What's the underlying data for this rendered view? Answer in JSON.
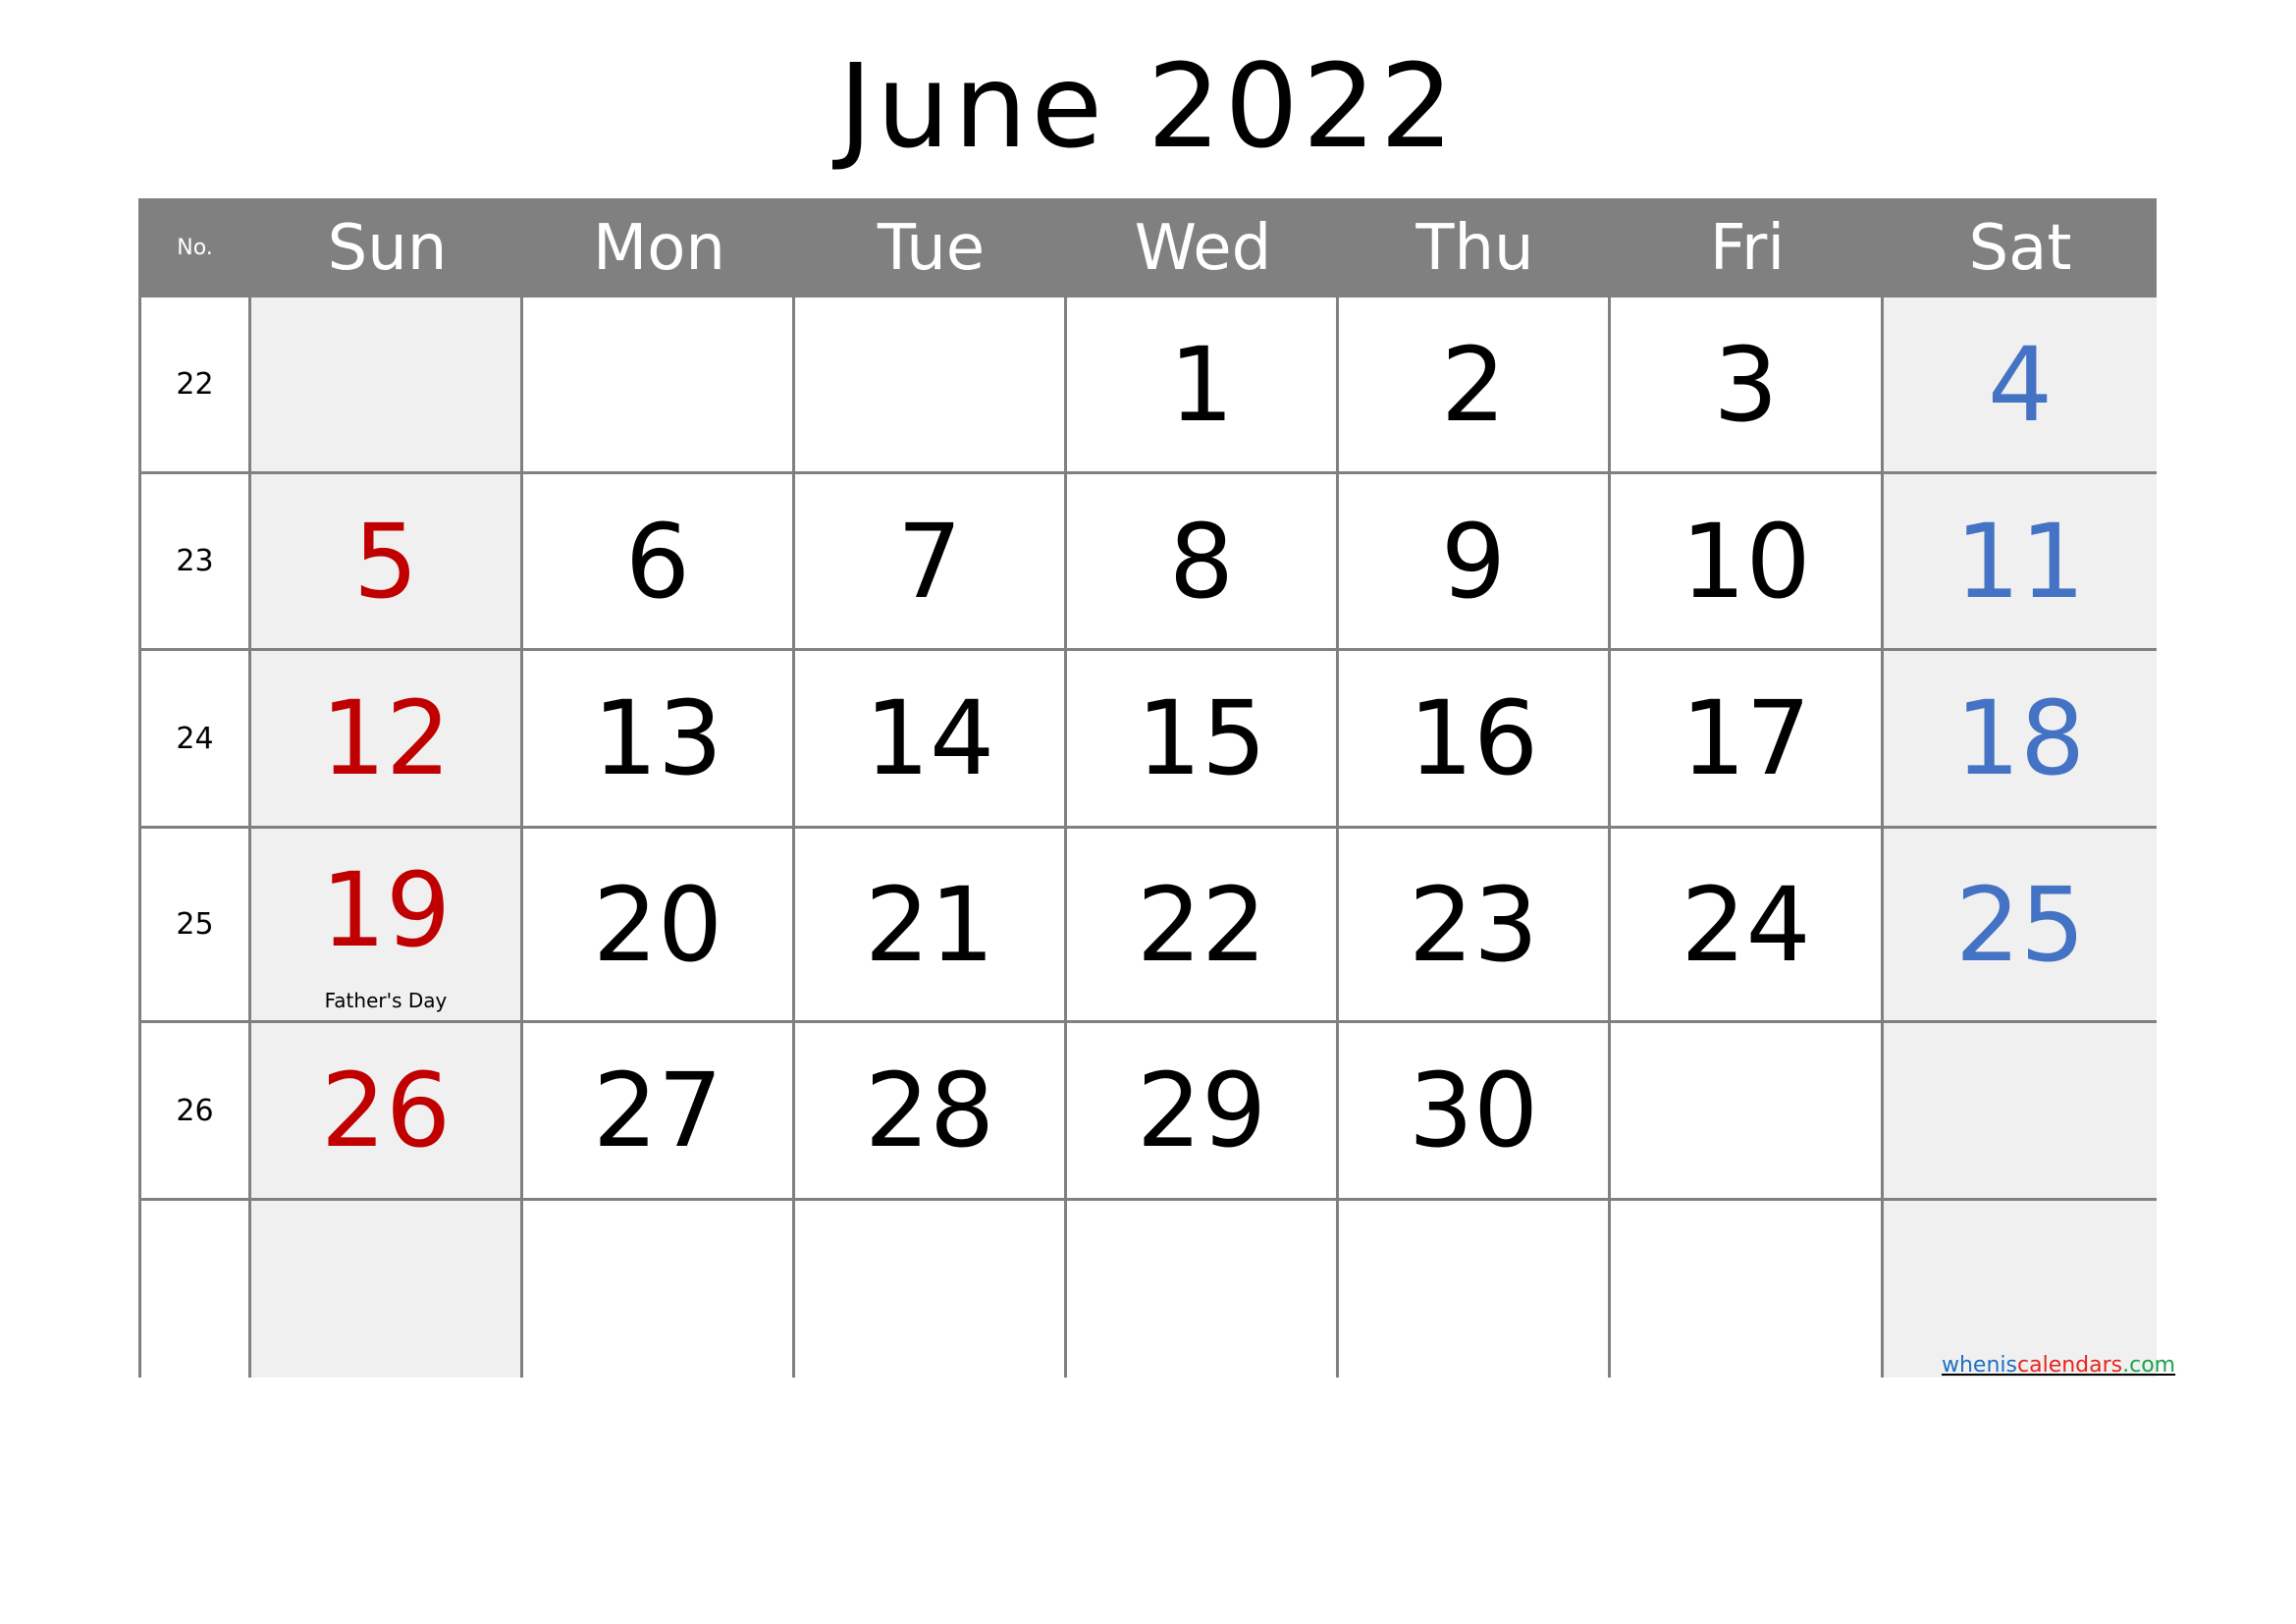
{
  "title": "June 2022",
  "header": {
    "week_no_label": "No.",
    "days": [
      "Sun",
      "Mon",
      "Tue",
      "Wed",
      "Thu",
      "Fri",
      "Sat"
    ]
  },
  "colors": {
    "header_bg": "#808080",
    "weekend_bg": "#f0f0f0",
    "sunday_text": "#c00000",
    "saturday_text": "#4472c4",
    "weekday_text": "#000000"
  },
  "weeks": [
    {
      "no": "22",
      "days": [
        "",
        "",
        "",
        "1",
        "2",
        "3",
        "4"
      ]
    },
    {
      "no": "23",
      "days": [
        "5",
        "6",
        "7",
        "8",
        "9",
        "10",
        "11"
      ]
    },
    {
      "no": "24",
      "days": [
        "12",
        "13",
        "14",
        "15",
        "16",
        "17",
        "18"
      ]
    },
    {
      "no": "25",
      "days": [
        "19",
        "20",
        "21",
        "22",
        "23",
        "24",
        "25"
      ],
      "notes": {
        "0": "Father's Day"
      }
    },
    {
      "no": "26",
      "days": [
        "26",
        "27",
        "28",
        "29",
        "30",
        "",
        ""
      ]
    },
    {
      "no": "",
      "days": [
        "",
        "",
        "",
        "",
        "",
        "",
        ""
      ]
    }
  ],
  "watermark": {
    "part1": "whenis",
    "part2": "calendars",
    "part3": ".com"
  }
}
